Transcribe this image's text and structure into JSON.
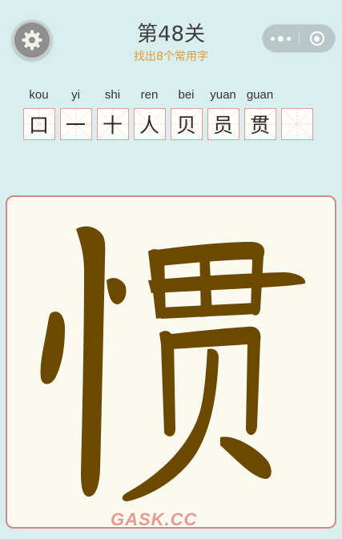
{
  "header": {
    "title": "第48关",
    "subtitle": "找出8个常用字"
  },
  "words": [
    {
      "pinyin": "kou",
      "char": "口"
    },
    {
      "pinyin": "yi",
      "char": "一"
    },
    {
      "pinyin": "shi",
      "char": "十"
    },
    {
      "pinyin": "ren",
      "char": "人"
    },
    {
      "pinyin": "bei",
      "char": "贝"
    },
    {
      "pinyin": "yuan",
      "char": "员"
    },
    {
      "pinyin": "guan",
      "char": "贯"
    },
    {
      "pinyin": "",
      "char": ""
    }
  ],
  "main_character": "惯",
  "watermark": "GASK.CC",
  "colors": {
    "background": "#d8efee",
    "subtitle": "#e39a3c",
    "stroke": "#6b4a00",
    "panel_border": "#cf8b8b"
  },
  "icons": {
    "settings": "gear-icon",
    "more": "more-dots-icon",
    "close": "close-target-icon"
  }
}
